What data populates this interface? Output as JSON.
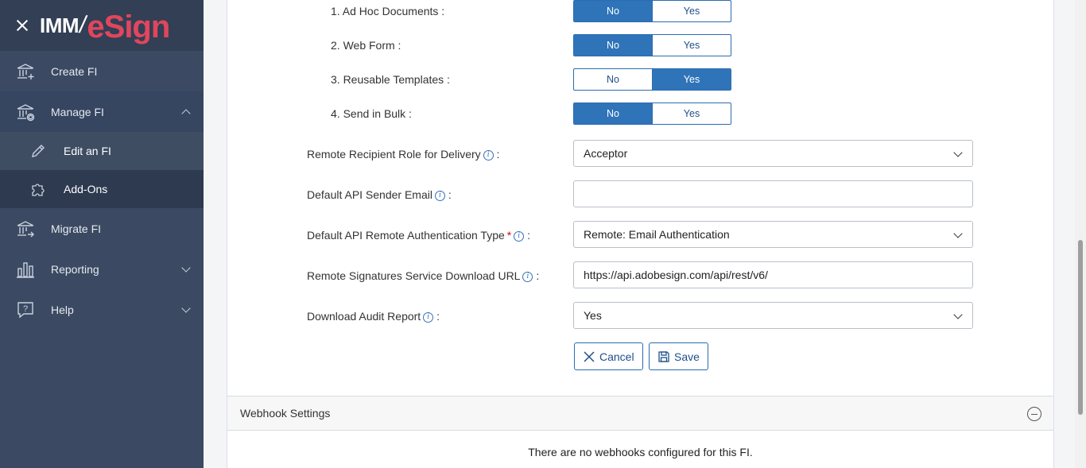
{
  "app": {
    "logo_prefix": "IMM",
    "logo_suffix": "eSign"
  },
  "sidebar": {
    "items": [
      {
        "label": "Create FI",
        "icon": "bank-plus-icon"
      },
      {
        "label": "Manage FI",
        "icon": "bank-gear-icon",
        "expanded": true
      },
      {
        "label": "Edit an FI",
        "icon": "pencil-icon",
        "selected": true
      },
      {
        "label": "Add-Ons",
        "icon": "puzzle-icon"
      },
      {
        "label": "Migrate FI",
        "icon": "bank-arrow-icon"
      },
      {
        "label": "Reporting",
        "icon": "bar-chart-icon"
      },
      {
        "label": "Help",
        "icon": "help-bubble-icon"
      }
    ]
  },
  "features": [
    {
      "label": "1. Ad Hoc Documents :",
      "no": "No",
      "yes": "Yes",
      "selected": "No"
    },
    {
      "label": "2. Web Form :",
      "no": "No",
      "yes": "Yes",
      "selected": "No"
    },
    {
      "label": "3. Reusable Templates :",
      "no": "No",
      "yes": "Yes",
      "selected": "Yes"
    },
    {
      "label": "4. Send in Bulk :",
      "no": "No",
      "yes": "Yes",
      "selected": "No"
    }
  ],
  "form": {
    "remote_role": {
      "label": "Remote Recipient Role for Delivery",
      "suffix": ":",
      "value": "Acceptor"
    },
    "sender_email": {
      "label": "Default API Sender Email",
      "suffix": ":",
      "value": ""
    },
    "auth_type": {
      "label": "Default API Remote Authentication Type",
      "required": "*",
      "suffix": ":",
      "value": "Remote: Email Authentication"
    },
    "download_url": {
      "label": "Remote Signatures Service Download URL",
      "suffix": ":",
      "value": "https://api.adobesign.com/api/rest/v6/"
    },
    "audit_report": {
      "label": "Download Audit Report",
      "suffix": ":",
      "value": "Yes"
    },
    "info_glyph": "i"
  },
  "actions": {
    "cancel": "Cancel",
    "save": "Save"
  },
  "webhooks": {
    "title": "Webhook Settings",
    "empty_message": "There are no webhooks configured for this FI."
  },
  "colors": {
    "sidebar_bg": "#3b4a62",
    "accent": "#2f74b8",
    "logo_red": "#e0465d",
    "logo_purple": "#9a5bd8"
  }
}
